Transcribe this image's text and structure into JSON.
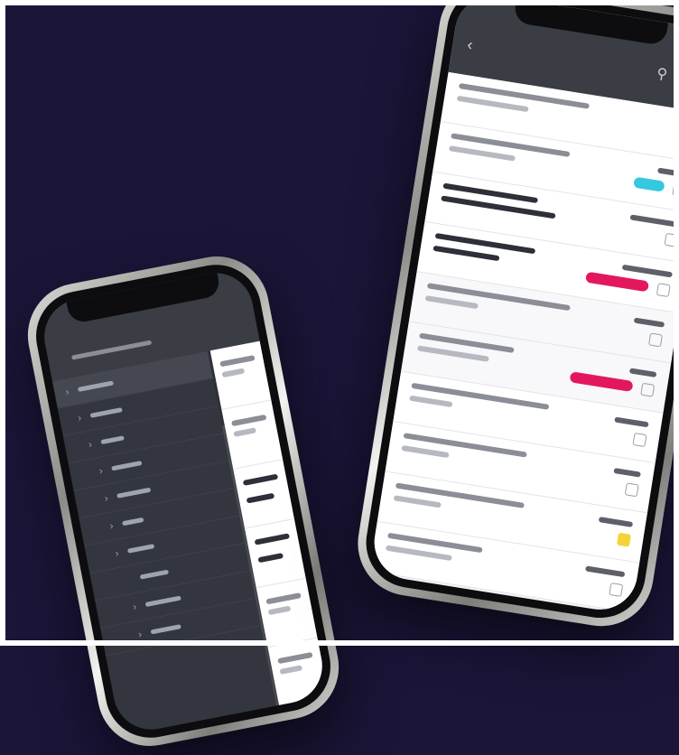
{
  "scene": {
    "background_color": "#1b1538",
    "accent_colors": {
      "cyan_tag": "#35c8df",
      "pink_tag": "#e3175e",
      "yellow_badge": "#f5d23a"
    }
  },
  "right_phone": {
    "header_title": "",
    "icons": [
      "back-icon",
      "search-icon",
      "edit-icon"
    ],
    "rows": 10
  },
  "left_phone": {
    "header_title": "",
    "nav_items": 9,
    "panel_rows": 8
  }
}
